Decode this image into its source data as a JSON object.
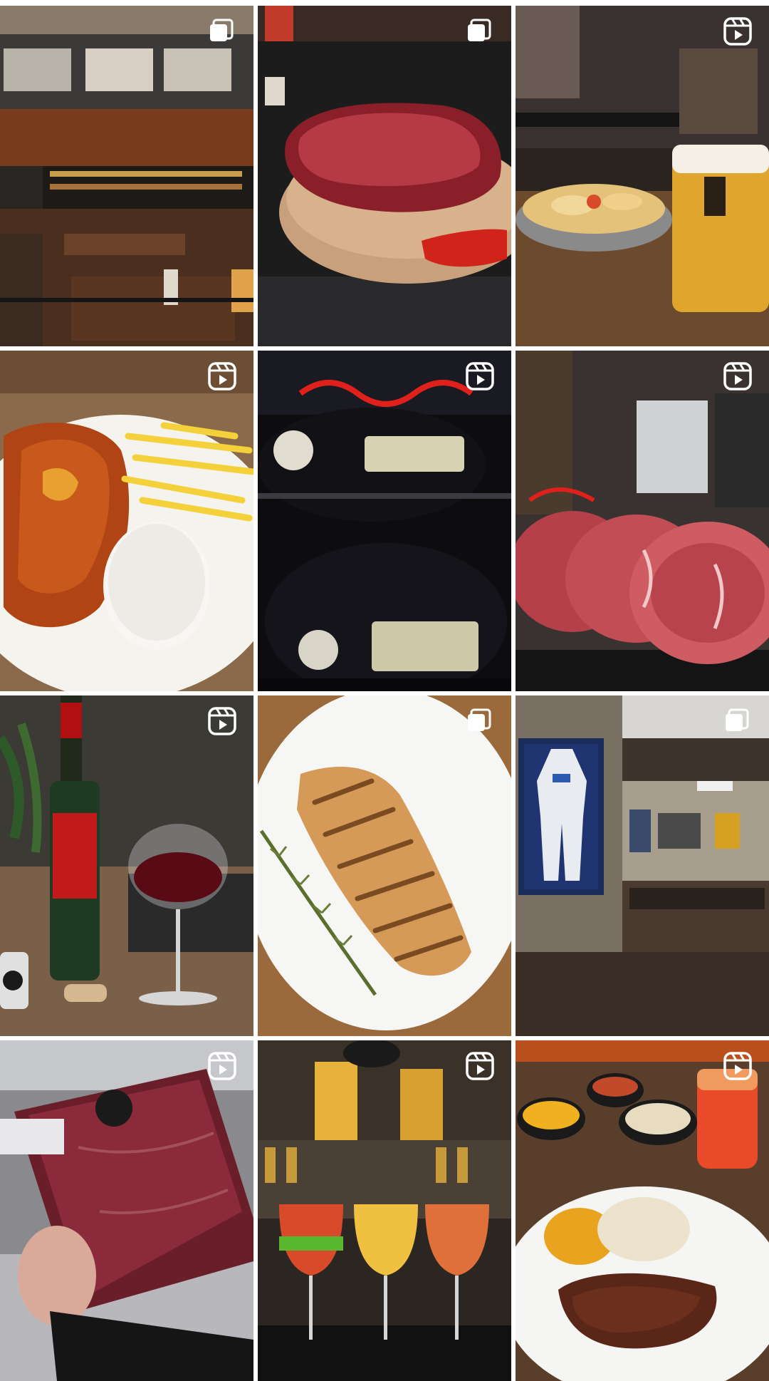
{
  "grid": {
    "posts": [
      {
        "id": "post-1",
        "type": "carousel",
        "badge_icon": "carousel-icon",
        "subject": "restaurant-interior",
        "colors": [
          "#4a2a1c",
          "#7a3e22",
          "#2b2b2b"
        ]
      },
      {
        "id": "post-2",
        "type": "carousel",
        "badge_icon": "carousel-icon",
        "subject": "raw-steak-on-board",
        "colors": [
          "#1e1e1e",
          "#a33a3e",
          "#c9a27e"
        ]
      },
      {
        "id": "post-3",
        "type": "reel",
        "badge_icon": "reels-icon",
        "subject": "beer-and-pastels",
        "colors": [
          "#2a2420",
          "#e0a52c",
          "#6b4a30"
        ]
      },
      {
        "id": "post-4",
        "type": "reel",
        "badge_icon": "reels-icon",
        "subject": "parmigiana-fries-rice",
        "colors": [
          "#b64d1b",
          "#f4d13a",
          "#f3f1ea"
        ]
      },
      {
        "id": "post-5",
        "type": "reel",
        "badge_icon": "reels-icon",
        "subject": "goodyear-racing-caps",
        "colors": [
          "#0e0e12",
          "#c0201a",
          "#d6d2b2"
        ]
      },
      {
        "id": "post-6",
        "type": "reel",
        "badge_icon": "reels-icon",
        "subject": "raw-ribeye-steaks",
        "colors": [
          "#3a302c",
          "#c24d55",
          "#e9b4b8"
        ]
      },
      {
        "id": "post-7",
        "type": "reel",
        "badge_icon": "reels-icon",
        "subject": "red-wine-bottle-glass",
        "colors": [
          "#6b4a35",
          "#1f3a22",
          "#5a0a14"
        ]
      },
      {
        "id": "post-8",
        "type": "carousel",
        "badge_icon": "carousel-icon",
        "subject": "grilled-fish-rosemary",
        "colors": [
          "#f4f4f4",
          "#c9874a",
          "#6b7d3a"
        ]
      },
      {
        "id": "post-9",
        "type": "carousel",
        "badge_icon": "carousel-icon",
        "subject": "racing-suit-frame-dining",
        "colors": [
          "#4a3b30",
          "#1c2b55",
          "#c8c0b0"
        ]
      },
      {
        "id": "post-10",
        "type": "reel",
        "badge_icon": "reels-icon",
        "subject": "vacuum-packed-beef",
        "colors": [
          "#2a1d20",
          "#8a2a3a",
          "#c9c9c9"
        ]
      },
      {
        "id": "post-11",
        "type": "reel",
        "badge_icon": "reels-icon",
        "subject": "cocktails-bar",
        "colors": [
          "#2b2622",
          "#e7b23a",
          "#d94a2a"
        ]
      },
      {
        "id": "post-12",
        "type": "reel",
        "badge_icon": "reels-icon",
        "subject": "steak-rice-sides",
        "colors": [
          "#3a2a22",
          "#e8a41f",
          "#6b2f1e"
        ]
      }
    ]
  }
}
